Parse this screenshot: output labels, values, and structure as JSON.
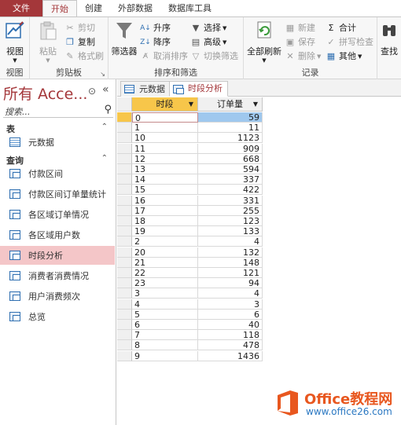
{
  "ribbon_tabs": [
    "文件",
    "开始",
    "创建",
    "外部数据",
    "数据库工具"
  ],
  "ribbon": {
    "view": {
      "button": "视图",
      "group": "视图"
    },
    "clipboard": {
      "paste": "粘贴",
      "cut": "剪切",
      "copy": "复制",
      "format_painter": "格式刷",
      "group": "剪贴板"
    },
    "sort_filter": {
      "filter": "筛选器",
      "ascending": "升序",
      "descending": "降序",
      "remove_sort": "取消排序",
      "selection": "选择",
      "advanced": "高级",
      "toggle_filter": "切换筛选",
      "group": "排序和筛选"
    },
    "records": {
      "refresh_all": "全部刷新",
      "new": "新建",
      "save": "保存",
      "delete": "删除",
      "totals": "合计",
      "spelling": "拼写检查",
      "more": "其他",
      "group": "记录"
    },
    "find": {
      "find": "查找"
    }
  },
  "nav": {
    "title": "所有 Acce...",
    "search_placeholder": "搜索...",
    "sections": {
      "tables": {
        "label": "表",
        "items": [
          "元数据"
        ]
      },
      "queries": {
        "label": "查询",
        "items": [
          "付款区间",
          "付款区间订单量统计",
          "各区域订单情况",
          "各区域用户数",
          "时段分析",
          "消费者消费情况",
          "用户消费频次",
          "总览"
        ]
      }
    },
    "selected": "时段分析"
  },
  "doc_tabs": [
    {
      "label": "元数据",
      "active": false
    },
    {
      "label": "时段分析",
      "active": true
    }
  ],
  "grid": {
    "columns": [
      "时段",
      "订单量"
    ],
    "rows": [
      [
        "0",
        "59"
      ],
      [
        "1",
        "11"
      ],
      [
        "10",
        "1123"
      ],
      [
        "11",
        "909"
      ],
      [
        "12",
        "668"
      ],
      [
        "13",
        "594"
      ],
      [
        "14",
        "337"
      ],
      [
        "15",
        "422"
      ],
      [
        "16",
        "331"
      ],
      [
        "17",
        "255"
      ],
      [
        "18",
        "123"
      ],
      [
        "19",
        "133"
      ],
      [
        "2",
        "4"
      ],
      [
        "20",
        "132"
      ],
      [
        "21",
        "148"
      ],
      [
        "22",
        "121"
      ],
      [
        "23",
        "94"
      ],
      [
        "3",
        "4"
      ],
      [
        "4",
        "3"
      ],
      [
        "5",
        "6"
      ],
      [
        "6",
        "40"
      ],
      [
        "7",
        "118"
      ],
      [
        "8",
        "478"
      ],
      [
        "9",
        "1436"
      ]
    ]
  },
  "watermark": {
    "brand": "Office教程网",
    "url": "www.office26.com"
  },
  "colors": {
    "accent": "#a4373a",
    "selection": "#f7c64a",
    "highlight": "#9fc8ee"
  }
}
